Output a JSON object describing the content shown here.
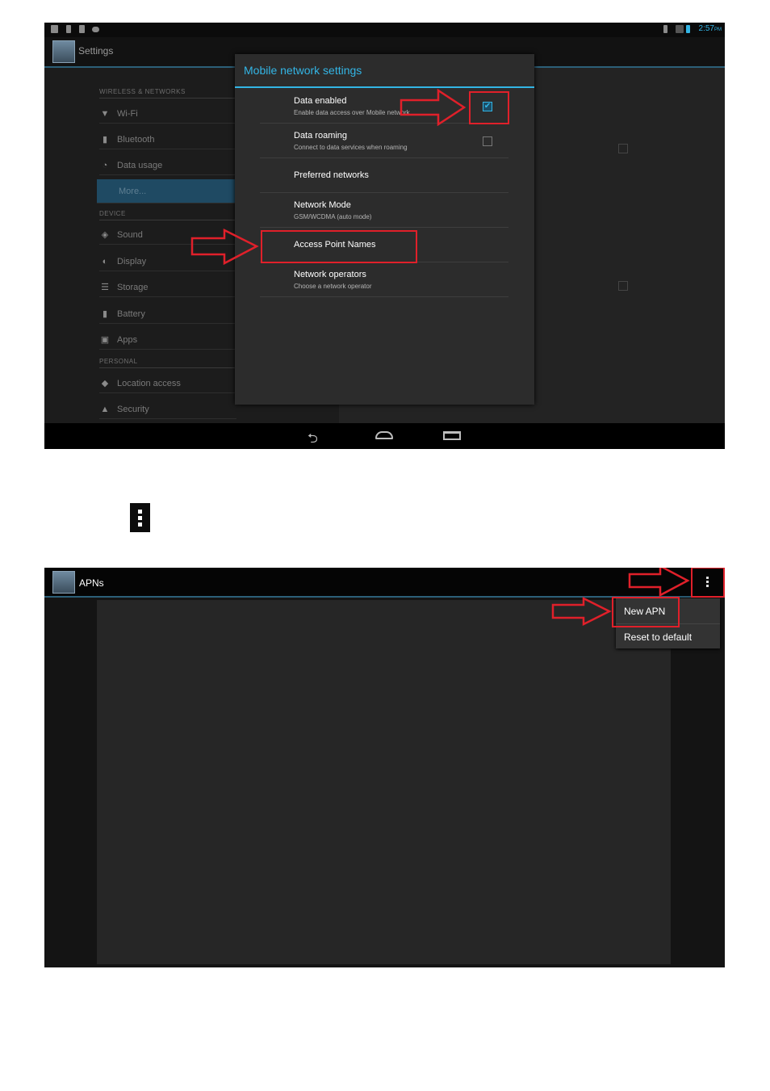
{
  "screen1": {
    "status_time": "2:57",
    "status_ampm": "PM",
    "app_title": "Settings",
    "sidebar": {
      "section_wireless": "WIRELESS & NETWORKS",
      "section_device": "DEVICE",
      "section_personal": "PERSONAL",
      "items": [
        {
          "label": "Wi-Fi",
          "icon": "wifi-icon"
        },
        {
          "label": "Bluetooth",
          "icon": "bluetooth-icon"
        },
        {
          "label": "Data usage",
          "icon": "data-usage-icon"
        },
        {
          "label": "More...",
          "icon": "",
          "selected": true
        },
        {
          "label": "Sound",
          "icon": "sound-icon"
        },
        {
          "label": "Display",
          "icon": "display-icon"
        },
        {
          "label": "Storage",
          "icon": "storage-icon"
        },
        {
          "label": "Battery",
          "icon": "battery-icon"
        },
        {
          "label": "Apps",
          "icon": "apps-icon"
        },
        {
          "label": "Location access",
          "icon": "location-icon"
        },
        {
          "label": "Security",
          "icon": "lock-icon"
        }
      ]
    },
    "dialog": {
      "title": "Mobile network settings",
      "items": [
        {
          "title": "Data enabled",
          "summary": "Enable data access over Mobile network",
          "checked": true
        },
        {
          "title": "Data roaming",
          "summary": "Connect to data services when roaming",
          "checked": false
        },
        {
          "title": "Preferred networks",
          "summary": ""
        },
        {
          "title": "Network Mode",
          "summary": "GSM/WCDMA (auto mode)"
        },
        {
          "title": "Access Point Names",
          "summary": ""
        },
        {
          "title": "Network operators",
          "summary": "Choose a network operator"
        }
      ]
    }
  },
  "screen2": {
    "app_title": "APNs",
    "menu": {
      "new_apn": "New APN",
      "reset": "Reset to default"
    }
  },
  "colors": {
    "accent": "#33b5e5",
    "highlight_red": "#e0202a"
  }
}
